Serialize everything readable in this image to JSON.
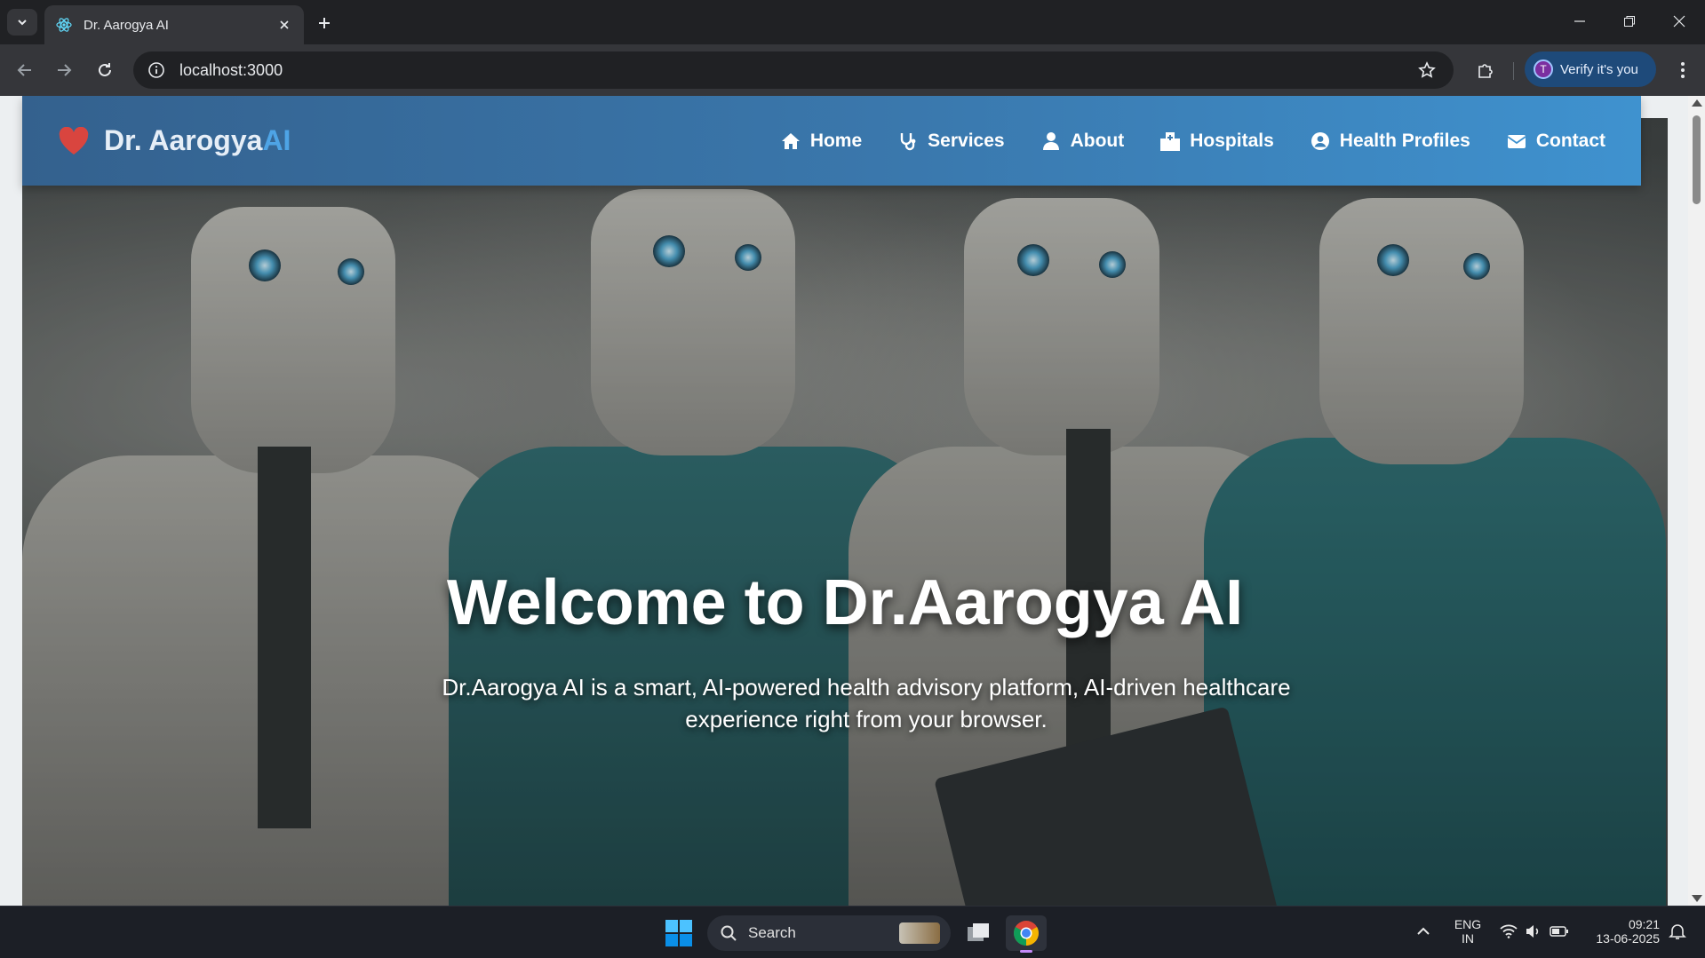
{
  "browser": {
    "tab_title": "Dr. Aarogya AI",
    "url": "localhost:3000",
    "profile_initial": "T",
    "verify_label": "Verify it's you"
  },
  "site": {
    "logo_text": "Dr. Aarogya",
    "logo_text_ai": "AI",
    "nav": {
      "home": "Home",
      "services": "Services",
      "about": "About",
      "hospitals": "Hospitals",
      "health_profiles": "Health Profiles",
      "contact": "Contact"
    },
    "hero": {
      "title": "Welcome to Dr.Aarogya AI",
      "subtitle": "Dr.Aarogya AI is a smart, AI-powered health advisory platform, AI-driven healthcare experience right from your browser."
    }
  },
  "taskbar": {
    "search_label": "Search",
    "lang_top": "ENG",
    "lang_bottom": "IN",
    "time": "09:21",
    "date": "13-06-2025"
  },
  "colors": {
    "header_start": "#34618e",
    "header_end": "#3f92cf",
    "logo_accent": "#4ea4e6",
    "heart": "#d9453f"
  }
}
